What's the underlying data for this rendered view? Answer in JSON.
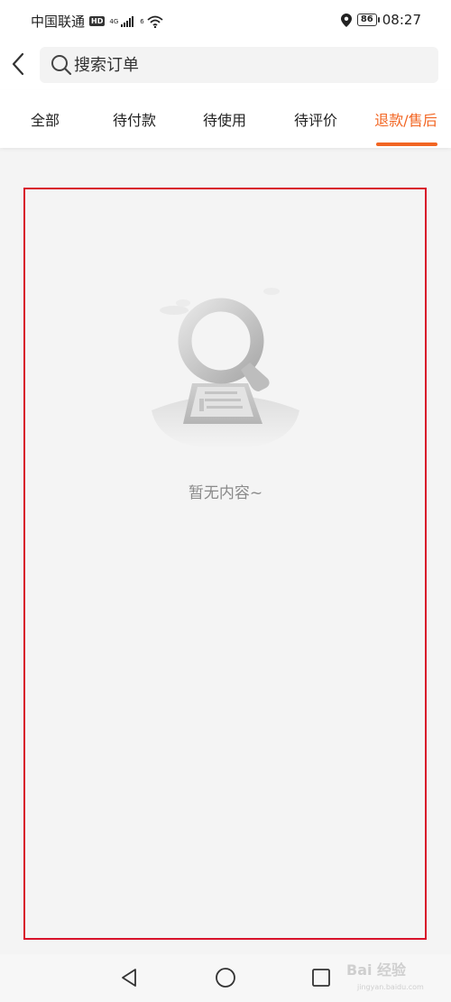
{
  "status_bar": {
    "carrier": "中国联通",
    "hd": "HD",
    "network": "4G",
    "wifi_badge": "6",
    "battery": "86",
    "time": "08:27"
  },
  "search": {
    "placeholder": "搜索订单"
  },
  "tabs": [
    {
      "label": "全部"
    },
    {
      "label": "待付款"
    },
    {
      "label": "待使用"
    },
    {
      "label": "待评价"
    },
    {
      "label": "退款/售后",
      "active": true
    }
  ],
  "empty_state": {
    "message": "暂无内容~"
  },
  "colors": {
    "accent": "#f26522",
    "highlight_frame": "#d8122a",
    "background": "#f4f4f4"
  },
  "watermark": {
    "text": "Bai 经验",
    "sub": "jingyan.baidu.com"
  }
}
